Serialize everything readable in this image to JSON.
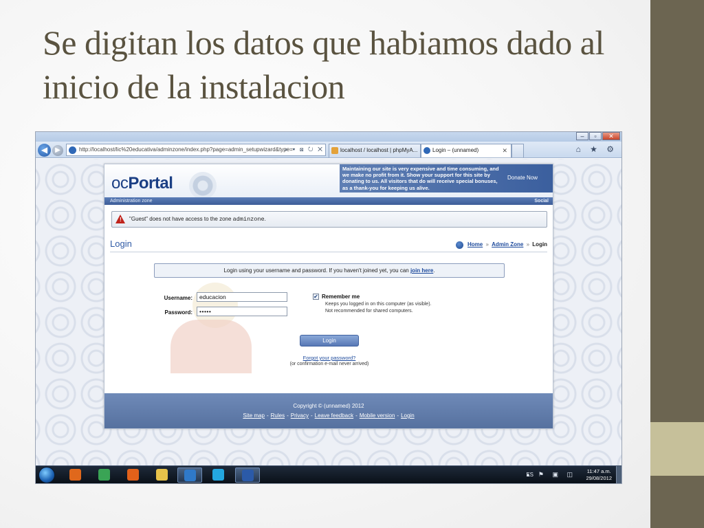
{
  "slide": {
    "title": "Se digitan los datos que habiamos dado al inicio de la instalacion"
  },
  "browser": {
    "window_buttons": [
      "–",
      "▫",
      "✕"
    ],
    "address": "http://localhost/lic%20educativa/adminzone/index.php?page=admin_setupwizard&type=",
    "address_tools": "⌕ ▾ ⊠ ↻ ✕",
    "tabs": [
      {
        "label": "localhost / localhost | phpMyA..."
      },
      {
        "label": "Login – (unnamed)",
        "close": "✕"
      }
    ],
    "right_tools": "⌂ ★ ⚙"
  },
  "page": {
    "logo": {
      "light": "oc",
      "bold": "Portal"
    },
    "donate_text": "Maintaining our site is very expensive and time consuming, and we make no profit from it. Show your support for this site by donating to us. All visitors that do will receive special bonuses, as a thank-you for keeping us alive.",
    "donate_link": "Donate Now",
    "zone_left": "Administration zone",
    "zone_right": "Social",
    "alert": {
      "prefix": "\"Guest\" does not have access to the zone ",
      "zone": "adminzone",
      "suffix": "."
    },
    "heading": "Login",
    "breadcrumb": {
      "home": "Home",
      "sep": "»",
      "admin": "Admin Zone",
      "current": "Login"
    },
    "info": {
      "text": "Login using your username and password. If you haven't joined yet, you can ",
      "link": "join here",
      "suffix": "."
    },
    "form": {
      "username_label": "Username:",
      "username_value": "educacion",
      "password_label": "Password:",
      "password_value": "•••••",
      "remember_checked": "✔",
      "remember_label": "Remember me",
      "remember_help": "Keeps you logged in on this computer (as visible). Not recommended for shared computers.",
      "login_button": "Login",
      "forgot_link": "Forgot your password?",
      "forgot_sub": "(or confirmation e-mail never arrived)"
    },
    "footer": {
      "copyright": "Copyright © (unnamed) 2012",
      "links": [
        "Site map",
        "Rules",
        "Privacy",
        "Leave feedback",
        "Mobile version",
        "Login"
      ],
      "separator": "-"
    }
  },
  "taskbar": {
    "apps": [
      {
        "name": "media-player",
        "color": "#e0681c"
      },
      {
        "name": "chrome",
        "color": "#3aa455"
      },
      {
        "name": "firefox",
        "color": "#e2611a"
      },
      {
        "name": "explorer",
        "color": "#e7c24a"
      },
      {
        "name": "internet-explorer",
        "color": "#2f79c9"
      },
      {
        "name": "skype",
        "color": "#23a7e0"
      },
      {
        "name": "word",
        "color": "#2b5aa8"
      }
    ],
    "lang": "ES",
    "tray": "▴ ⚑ ▣ ◫",
    "time": "11:47 a.m.",
    "date": "29/08/2012"
  }
}
